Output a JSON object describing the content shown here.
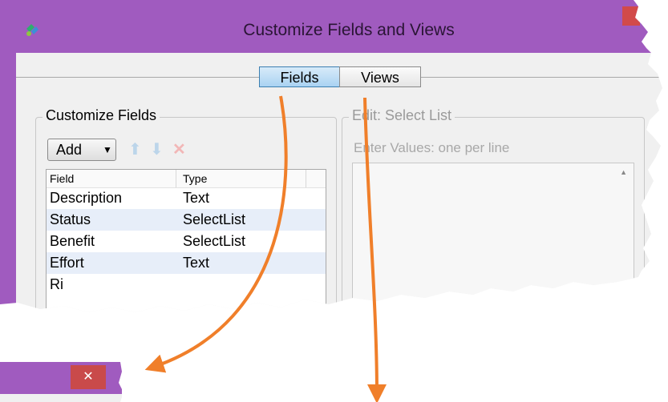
{
  "window": {
    "title": "Customize Fields and Views",
    "accent_color": "#a05bbf"
  },
  "tabs": [
    {
      "label": "Fields",
      "selected": true
    },
    {
      "label": "Views",
      "selected": false
    }
  ],
  "customize": {
    "legend": "Customize Fields",
    "add_label": "Add",
    "icons": {
      "up": "arrow-up-icon",
      "down": "arrow-down-icon",
      "delete": "delete-icon"
    },
    "columns": [
      "Field",
      "Type"
    ],
    "rows": [
      {
        "field": "Description",
        "type": "Text"
      },
      {
        "field": "Status",
        "type": "SelectList"
      },
      {
        "field": "Benefit",
        "type": "SelectList"
      },
      {
        "field": "Effort",
        "type": "Text"
      },
      {
        "field": "Ri",
        "type": ""
      }
    ]
  },
  "edit": {
    "legend": "Edit: Select List",
    "hint": "Enter Values: one per line"
  },
  "snippet": {
    "close_glyph": "✕"
  },
  "annotation": {
    "arrow_color": "#f07f2a"
  }
}
